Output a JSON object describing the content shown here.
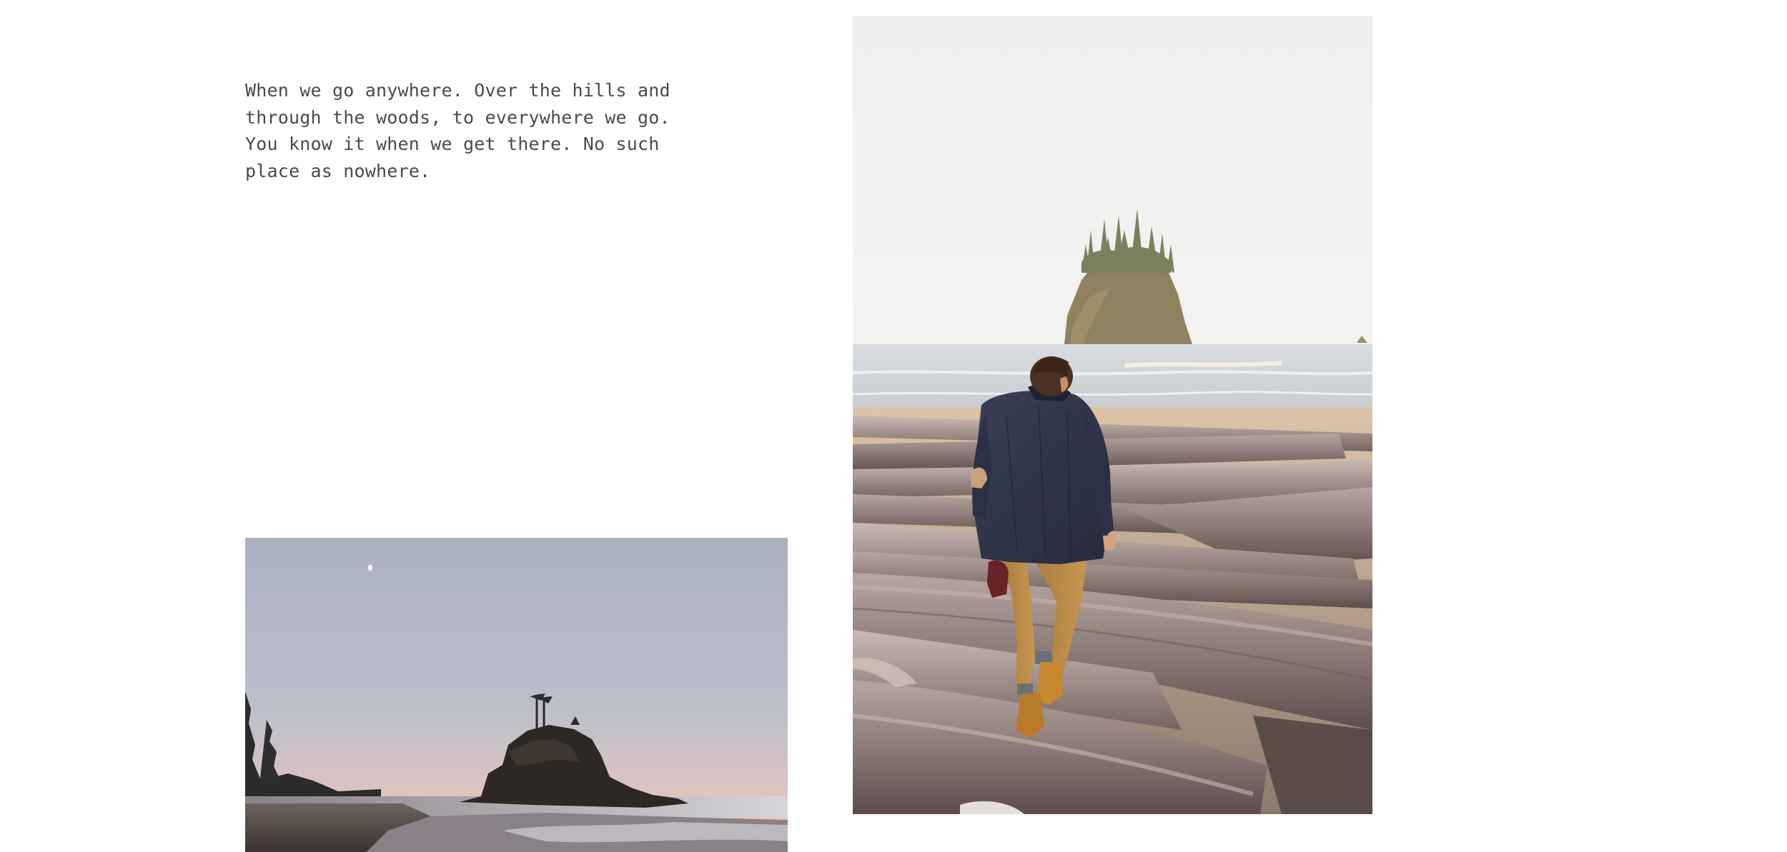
{
  "intro": {
    "text": "When we go anywhere. Over the hills and\nthrough the woods, to everywhere we go.\nYou know it when we get there. No such\nplace as nowhere."
  },
  "photos": {
    "left": {
      "subject": "sunset-sea-stack-beach-photo"
    },
    "right": {
      "subject": "hiker-on-driftwood-beach-photo"
    }
  },
  "colors": {
    "background": "#ffffff",
    "text": "#4a4a4a"
  }
}
